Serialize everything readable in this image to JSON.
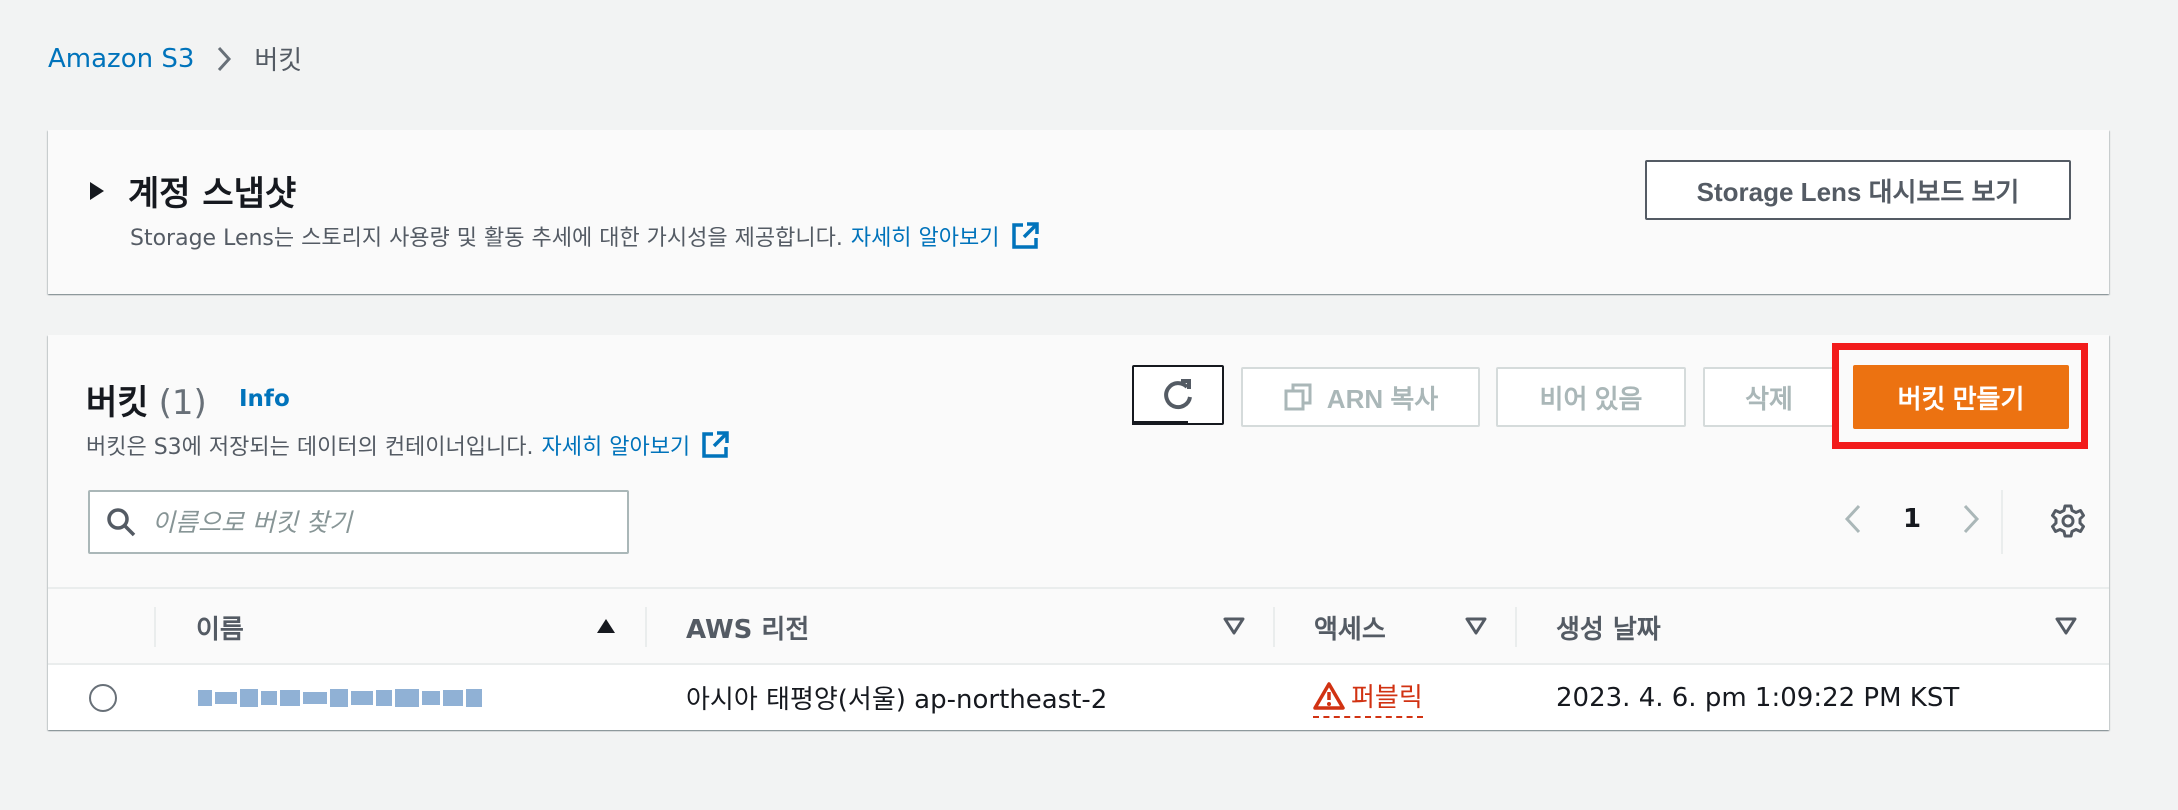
{
  "breadcrumb": {
    "root": "Amazon S3",
    "current": "버킷"
  },
  "snapshot": {
    "title": "계정 스냅샷",
    "description": "Storage Lens는 스토리지 사용량 및 활동 추세에 대한 가시성을 제공합니다.",
    "learn_more": "자세히 알아보기",
    "dashboard_button": "Storage Lens 대시보드 보기"
  },
  "buckets": {
    "title": "버킷",
    "count": "(1)",
    "info": "Info",
    "description": "버킷은 S3에 저장되는 데이터의 컨테이너입니다.",
    "learn_more": "자세히 알아보기",
    "actions": {
      "copy_arn": "ARN 복사",
      "empty": "비어 있음",
      "delete": "삭제",
      "create": "버킷 만들기"
    },
    "search": {
      "placeholder": "이름으로 버킷 찾기"
    },
    "pagination": {
      "current_page": "1"
    },
    "columns": {
      "name": "이름",
      "region": "AWS 리전",
      "access": "액세스",
      "created": "생성 날짜"
    },
    "rows": [
      {
        "region": "아시아 태평양(서울) ap-northeast-2",
        "access": "퍼블릭",
        "created": "2023. 4. 6. pm 1:09:22 PM KST"
      }
    ]
  },
  "colors": {
    "link": "#0073bb",
    "primary": "#ec7211",
    "highlight": "#f21b1b",
    "danger": "#d13212"
  },
  "icons": [
    "chevron-right-icon",
    "caret-right-icon",
    "external-link-icon",
    "refresh-icon",
    "copy-icon",
    "search-icon",
    "chevron-left-icon",
    "gear-icon",
    "sort-asc-icon",
    "sort-desc-icon",
    "warning-icon"
  ]
}
